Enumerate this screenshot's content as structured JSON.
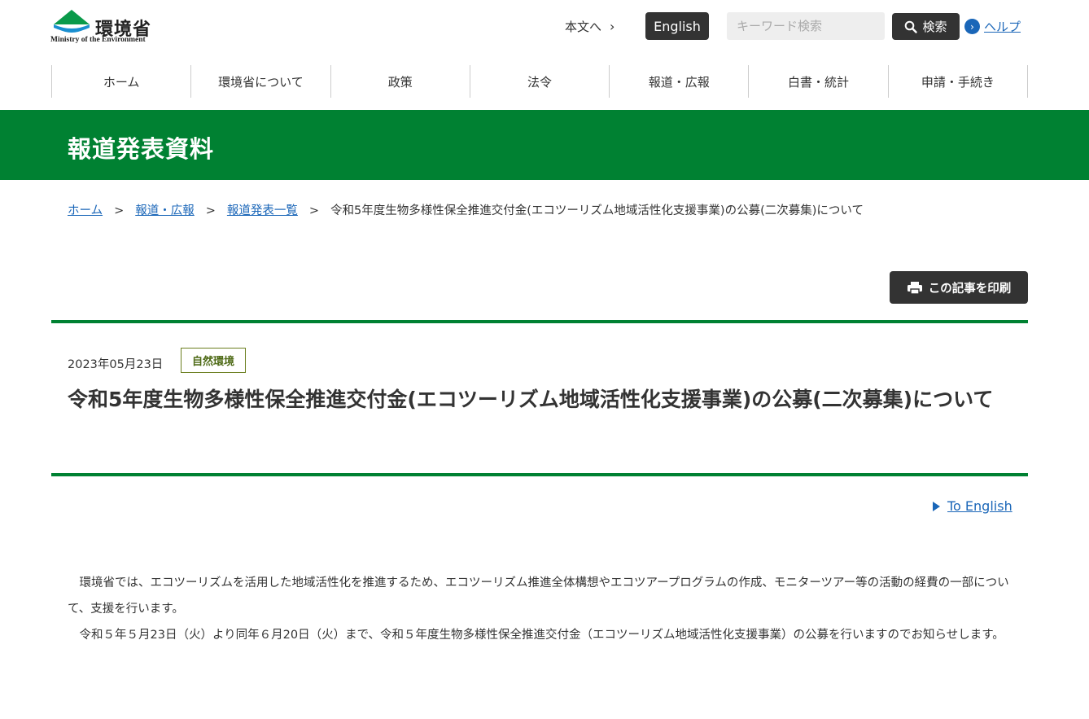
{
  "header": {
    "logo_name": "環境省",
    "logo_sub": "Ministry of the Environment",
    "skip_link": "本文へ",
    "english_button": "English",
    "search_placeholder": "キーワード検索",
    "search_button": "検索",
    "help_link": "ヘルプ"
  },
  "nav": [
    {
      "label": "ホーム"
    },
    {
      "label": "環境省について"
    },
    {
      "label": "政策"
    },
    {
      "label": "法令"
    },
    {
      "label": "報道・広報"
    },
    {
      "label": "白書・統計"
    },
    {
      "label": "申請・手続き"
    }
  ],
  "banner": {
    "title": "報道発表資料"
  },
  "breadcrumb": {
    "items": [
      "ホーム",
      "報道・広報",
      "報道発表一覧"
    ],
    "current": "令和5年度生物多様性保全推進交付金(エコツーリズム地域活性化支援事業)の公募(二次募集)について",
    "separator": ">"
  },
  "print_button": "この記事を印刷",
  "article": {
    "date": "2023年05月23日",
    "tag": "自然環境",
    "title": "令和5年度生物多様性保全推進交付金(エコツーリズム地域活性化支援事業)の公募(二次募集)について",
    "to_english": "To English",
    "paragraphs": [
      "環境省では、エコツーリズムを活用した地域活性化を推進するため、エコツーリズム推進全体構想やエコツアープログラムの作成、モニターツアー等の活動の経費の一部について、支援を行います。",
      "令和５年５月23日（火）より同年６月20日（火）まで、令和５年度生物多様性保全推進交付金（エコツーリズム地域活性化支援事業）の公募を行いますのでお知らせします。"
    ]
  },
  "colors": {
    "brand_green": "#008132",
    "link_blue": "#1a66b8",
    "dark_button": "#333333",
    "tag_olive": "#4e6a16"
  }
}
